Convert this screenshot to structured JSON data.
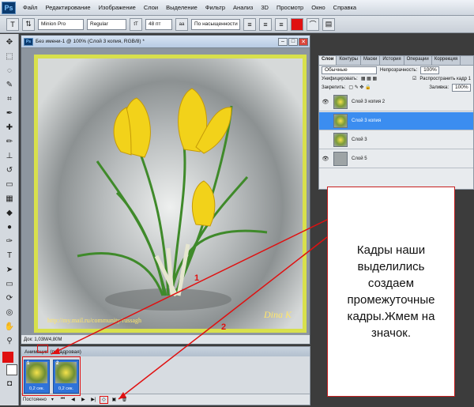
{
  "app": {
    "logo": "Ps"
  },
  "menu": [
    "Файл",
    "Редактирование",
    "Изображение",
    "Слои",
    "Выделение",
    "Фильтр",
    "Анализ",
    "3D",
    "Просмотр",
    "Окно",
    "Справка"
  ],
  "options": {
    "font_family": "Minion Pro",
    "font_style": "Regular",
    "font_size": "48 пт",
    "antialias": "По насыщенности",
    "tool_letter": "T"
  },
  "document": {
    "title": "Без имени-1 @ 100% (Слой 3 копия, RGB/8) *",
    "status": "Док: 1,03М/4,80М",
    "watermark": "http://my.mail.ru/community/russagh",
    "signature": "Dina K"
  },
  "layers_panel": {
    "tabs": [
      "Слои",
      "Контуры",
      "Маски",
      "История",
      "Операции",
      "Коррекция"
    ],
    "blend_mode": "Обычные",
    "opacity_label": "Непрозрачность:",
    "opacity_value": "100%",
    "unify_label": "Унифицировать:",
    "propagate_label": "Распространить кадр 1",
    "lock_label": "Закрепить:",
    "fill_label": "Заливка:",
    "fill_value": "100%",
    "layers": [
      {
        "name": "Слой 3 копия 2",
        "visible": true
      },
      {
        "name": "Слой 3 копия",
        "visible": false,
        "selected": true
      },
      {
        "name": "Слой 3",
        "visible": false
      },
      {
        "name": "Слой 5",
        "visible": true
      }
    ]
  },
  "animation": {
    "title": "Анимация (покадровая)",
    "frames": [
      {
        "num": "1",
        "delay": "0,2 сек."
      },
      {
        "num": "2",
        "delay": "0,2 сек."
      }
    ],
    "loop": "Постоянно"
  },
  "annotation": {
    "text": "Кадры наши\nвыделились\nсоздаем\nпромежуточные\nкадры.Жмем на\nзначок.",
    "marker1": "1",
    "marker2": "2"
  },
  "colors": {
    "accent_red": "#e01010",
    "selection": "#3b8df0"
  }
}
